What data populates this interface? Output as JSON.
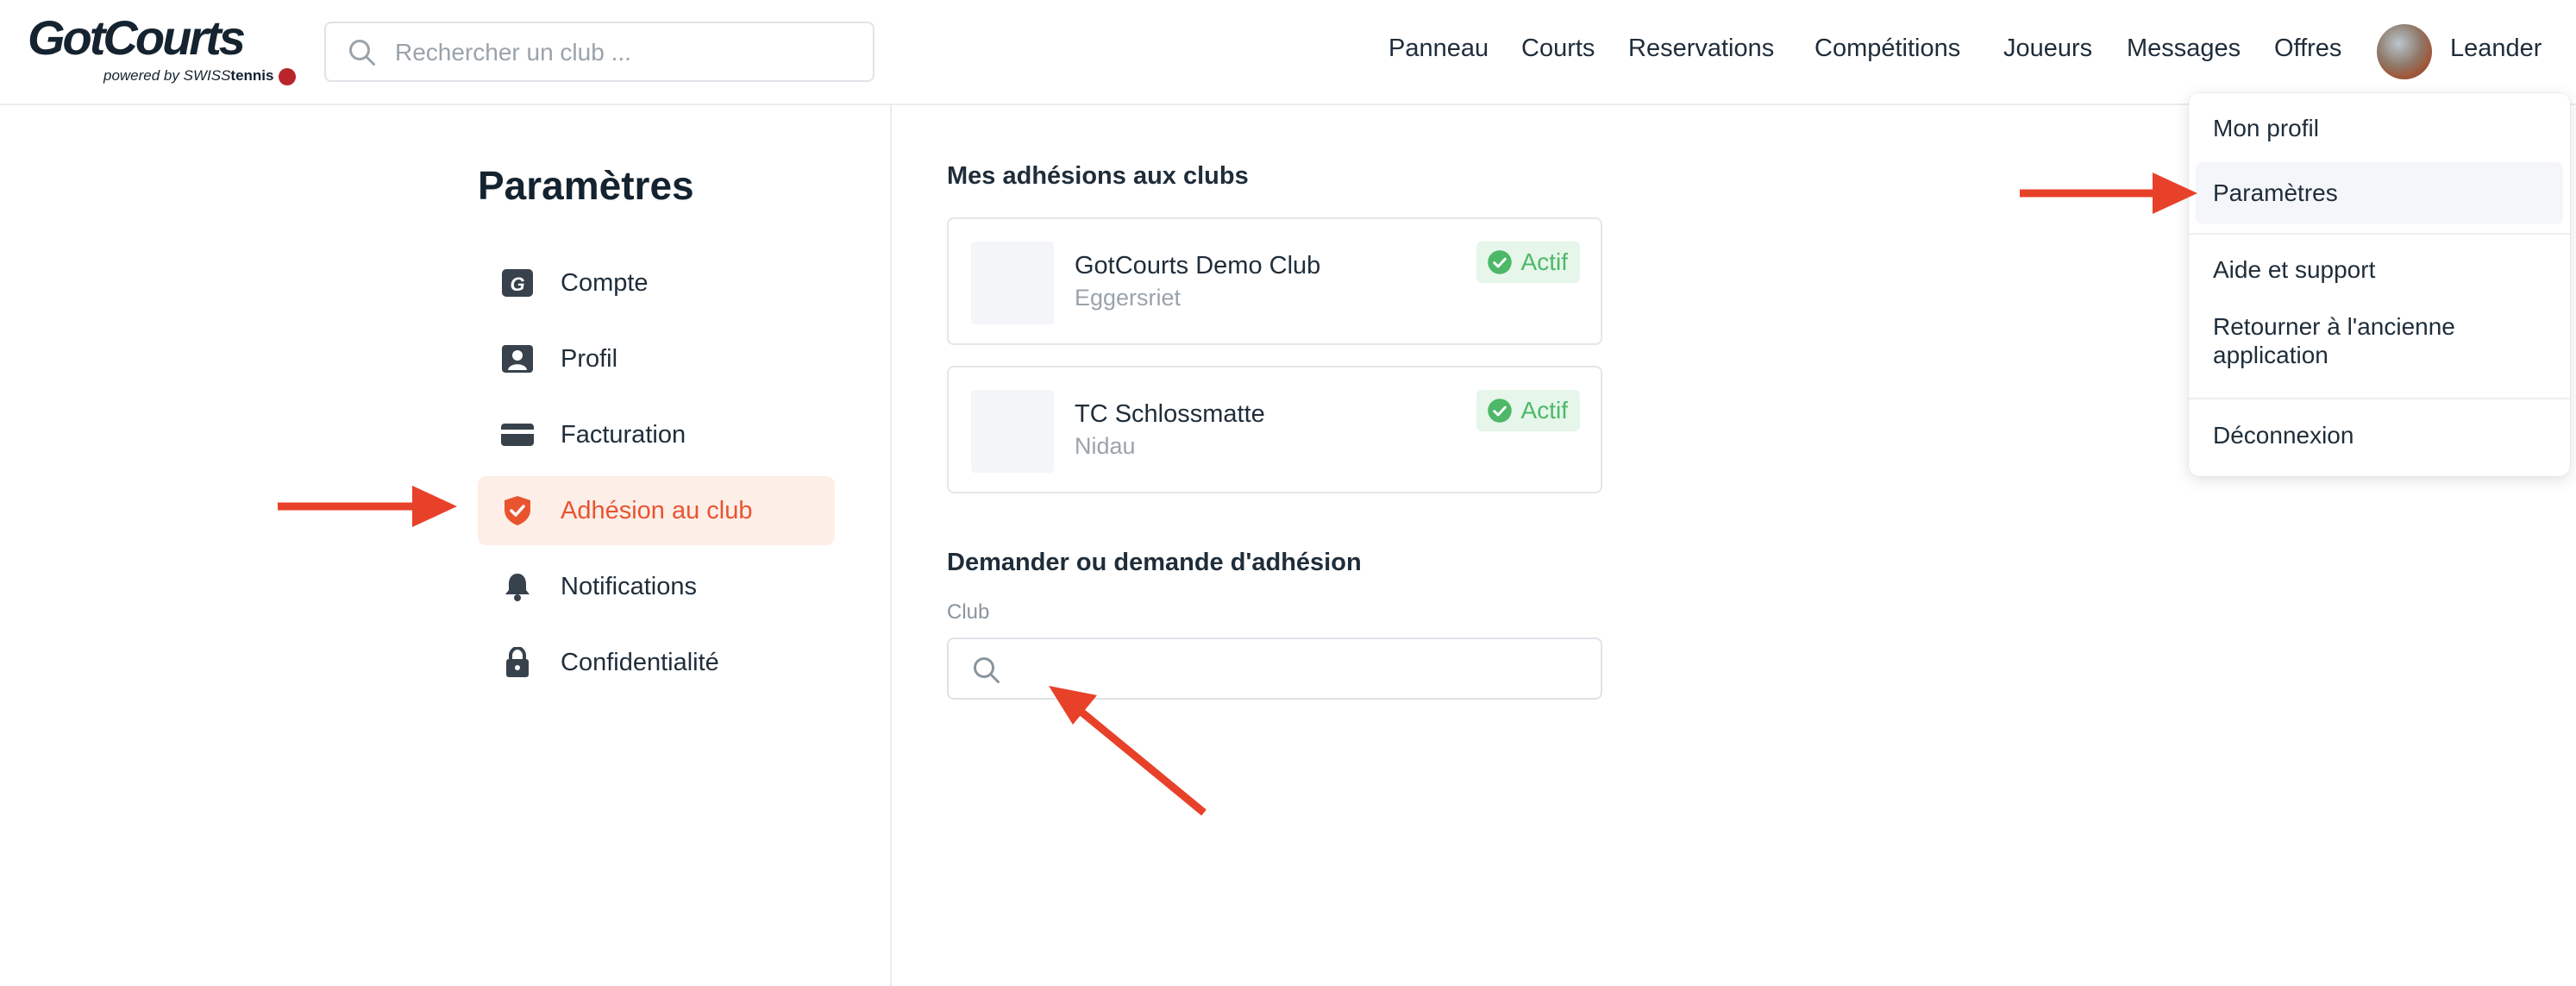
{
  "header": {
    "logo_text": "GotCourts",
    "logo_sub_prefix": "powered by ",
    "logo_sub_brand_swiss": "SWISS",
    "logo_sub_brand_tennis": "tennis",
    "search_placeholder": "Rechercher un club ...",
    "search_icon": "search-icon",
    "nav": [
      "Panneau",
      "Courts",
      "Reservations",
      "Compétitions",
      "Joueurs",
      "Messages",
      "Offres"
    ],
    "user_name": "Leander"
  },
  "sidebar": {
    "title": "Paramètres",
    "items": [
      {
        "label": "Compte",
        "icon": "account-g-icon"
      },
      {
        "label": "Profil",
        "icon": "profile-card-icon"
      },
      {
        "label": "Facturation",
        "icon": "credit-card-icon"
      },
      {
        "label": "Adhésion au club",
        "icon": "shield-check-icon",
        "active": true
      },
      {
        "label": "Notifications",
        "icon": "bell-icon"
      },
      {
        "label": "Confidentialité",
        "icon": "lock-icon"
      }
    ]
  },
  "main": {
    "memberships_title": "Mes adhésions aux clubs",
    "clubs": [
      {
        "name": "GotCourts Demo Club",
        "city": "Eggersriet",
        "status": "Actif"
      },
      {
        "name": "TC Schlossmatte",
        "city": "Nidau",
        "status": "Actif"
      }
    ],
    "request_title": "Demander ou demande d'adhésion",
    "club_field_label": "Club",
    "club_field_value": ""
  },
  "dropdown": {
    "items": [
      "Mon profil",
      "Paramètres",
      "Aide et support",
      "Retourner à l'ancienne application",
      "Déconnexion"
    ],
    "highlighted": "Paramètres"
  },
  "colors": {
    "accent": "#e9542f",
    "active_bg": "#fdeee8",
    "status_green": "#4cb868",
    "status_green_bg": "#e6f6ea",
    "annotation_arrow": "#e8412a",
    "text_dark": "#1f2d3a"
  }
}
